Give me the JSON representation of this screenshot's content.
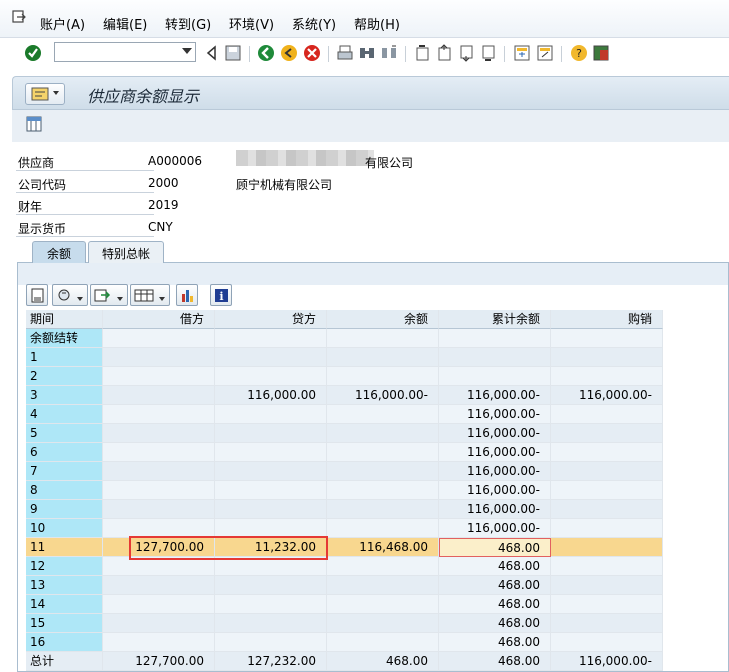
{
  "menubar": {
    "items": [
      "账户(A)",
      "编辑(E)",
      "转到(G)",
      "环境(V)",
      "系统(Y)",
      "帮助(H)"
    ]
  },
  "toolbar": {
    "command_field_value": ""
  },
  "title": "供应商余额显示",
  "header": {
    "fields": [
      {
        "label": "供应商",
        "value": "A000006",
        "desc": "有限公司"
      },
      {
        "label": "公司代码",
        "value": "2000",
        "desc": "顾宁机械有限公司"
      },
      {
        "label": "财年",
        "value": "2019",
        "desc": ""
      },
      {
        "label": "显示货币",
        "value": "CNY",
        "desc": ""
      }
    ]
  },
  "tabs": [
    {
      "label": "余额",
      "active": true
    },
    {
      "label": "特别总帐",
      "active": false
    }
  ],
  "table": {
    "columns": [
      "期间",
      "借方",
      "贷方",
      "余额",
      "累计余额",
      "购销"
    ],
    "rows": [
      [
        "余额结转",
        "",
        "",
        "",
        "",
        ""
      ],
      [
        "1",
        "",
        "",
        "",
        "",
        ""
      ],
      [
        "2",
        "",
        "",
        "",
        "",
        ""
      ],
      [
        "3",
        "",
        "116,000.00",
        "116,000.00-",
        "116,000.00-",
        "116,000.00-"
      ],
      [
        "4",
        "",
        "",
        "",
        "116,000.00-",
        ""
      ],
      [
        "5",
        "",
        "",
        "",
        "116,000.00-",
        ""
      ],
      [
        "6",
        "",
        "",
        "",
        "116,000.00-",
        ""
      ],
      [
        "7",
        "",
        "",
        "",
        "116,000.00-",
        ""
      ],
      [
        "8",
        "",
        "",
        "",
        "116,000.00-",
        ""
      ],
      [
        "9",
        "",
        "",
        "",
        "116,000.00-",
        ""
      ],
      [
        "10",
        "",
        "",
        "",
        "116,000.00-",
        ""
      ],
      [
        "11",
        "127,700.00",
        "11,232.00",
        "116,468.00",
        "468.00",
        ""
      ],
      [
        "12",
        "",
        "",
        "",
        "468.00",
        ""
      ],
      [
        "13",
        "",
        "",
        "",
        "468.00",
        ""
      ],
      [
        "14",
        "",
        "",
        "",
        "468.00",
        ""
      ],
      [
        "15",
        "",
        "",
        "",
        "468.00",
        ""
      ],
      [
        "16",
        "",
        "",
        "",
        "468.00",
        ""
      ],
      [
        "总计",
        "127,700.00",
        "127,232.00",
        "468.00",
        "468.00",
        "116,000.00-"
      ]
    ],
    "selected_row": 11
  }
}
